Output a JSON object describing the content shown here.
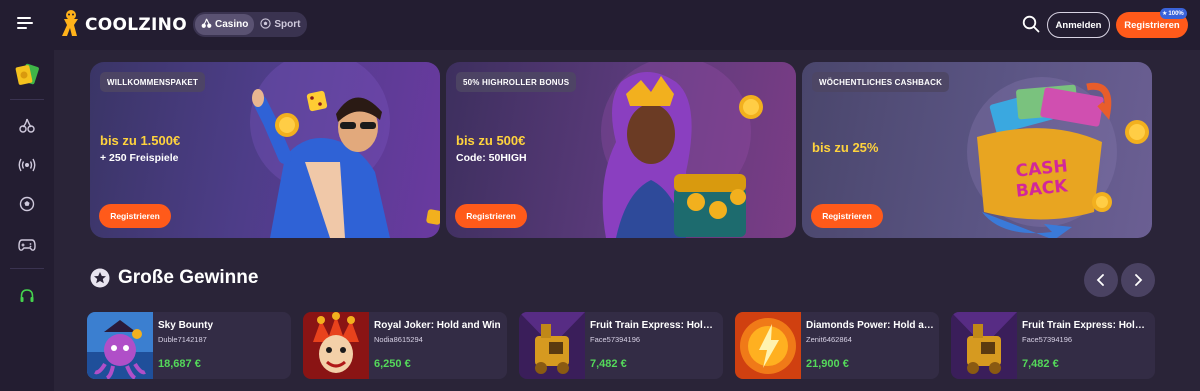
{
  "header": {
    "logo_text": "COOLZINO",
    "modes": [
      {
        "label": "Casino",
        "icon": "cherry-icon",
        "active": true
      },
      {
        "label": "Sport",
        "icon": "soccer-ball-icon",
        "active": false
      }
    ],
    "login_label": "Anmelden",
    "register_label": "Registrieren",
    "register_badge": "100%"
  },
  "sidebar": {
    "items": [
      {
        "name": "cashback-promo",
        "icon": "money-cards-icon"
      },
      {
        "name": "casino",
        "icon": "cherry-icon"
      },
      {
        "name": "live",
        "icon": "broadcast-icon"
      },
      {
        "name": "sport",
        "icon": "soccer-ball-icon"
      },
      {
        "name": "games",
        "icon": "gamepad-icon"
      },
      {
        "name": "support",
        "icon": "headset-icon"
      }
    ]
  },
  "promos": [
    {
      "tag": "WILLKOMMENSPAKET",
      "amount": "bis zu 1.500€",
      "sub": "+ 250 Freispiele",
      "cta": "Registrieren"
    },
    {
      "tag": "50% HIGHROLLER BONUS",
      "amount": "bis zu 500€",
      "sub": "Code: 50HIGH",
      "cta": "Registrieren"
    },
    {
      "tag": "WÖCHENTLICHES CASHBACK",
      "amount": "bis zu 25%",
      "sub": "",
      "cta": "Registrieren",
      "art_text_1": "CASH",
      "art_text_2": "BACK"
    }
  ],
  "big_wins": {
    "title": "Große Gewinne",
    "items": [
      {
        "game": "Sky Bounty",
        "user": "Duble7142187",
        "amount": "18,687 €"
      },
      {
        "game": "Royal Joker: Hold and Win",
        "user": "Nodia8615294",
        "amount": "6,250 €"
      },
      {
        "game": "Fruit Train Express: Hold and Win",
        "user": "Face57394196",
        "amount": "7,482 €"
      },
      {
        "game": "Diamonds Power: Hold and Win",
        "user": "Zenit6462864",
        "amount": "21,900 €"
      },
      {
        "game": "Fruit Train Express: Hold and Win",
        "user": "Face57394196",
        "amount": "7,482 €"
      }
    ]
  },
  "colors": {
    "background": "#2a2438",
    "header": "#231d31",
    "accent": "#ff5a1a",
    "bonus_yellow": "#ffd33d",
    "win_green": "#54d95a"
  }
}
